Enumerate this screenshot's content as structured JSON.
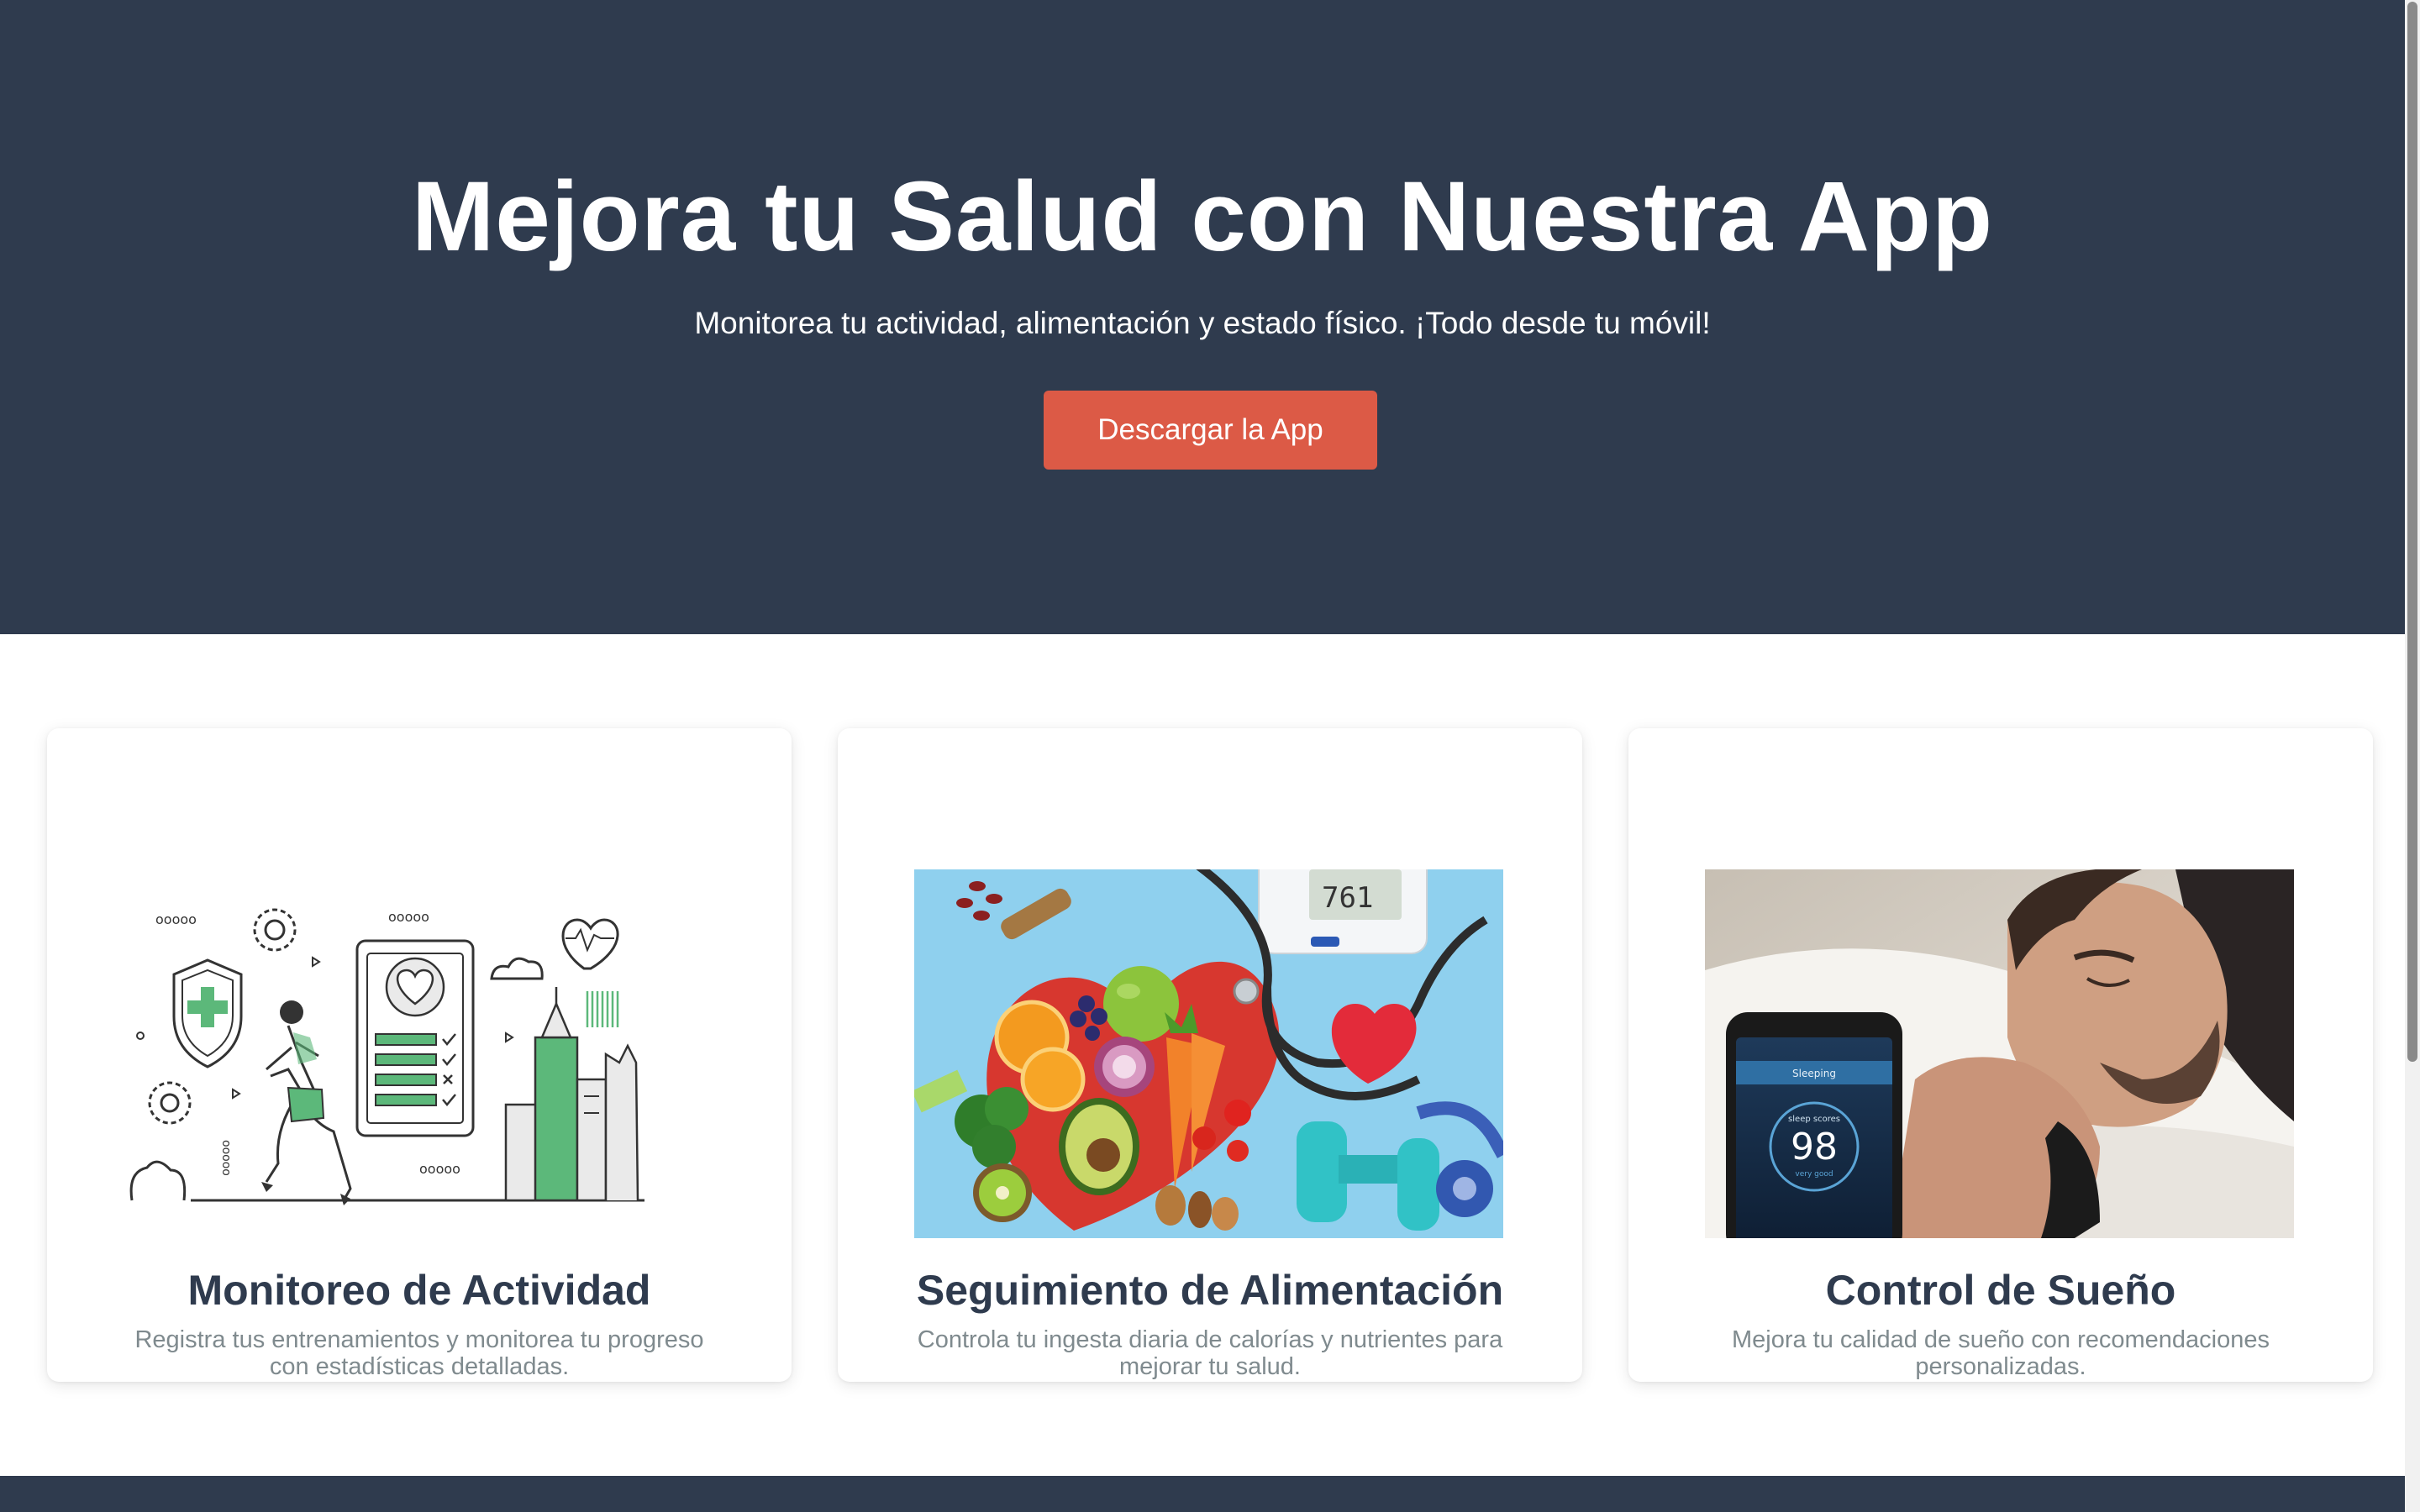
{
  "hero": {
    "title": "Mejora tu Salud con Nuestra App",
    "subtitle": "Monitorea tu actividad, alimentación y estado físico. ¡Todo desde tu móvil!",
    "cta_label": "Descargar la App"
  },
  "features": [
    {
      "title": "Monitoreo de Actividad",
      "description": "Registra tus entrenamientos y monitorea tu progreso con estadísticas detalladas.",
      "image": "activity-illustration"
    },
    {
      "title": "Seguimiento de Alimentación",
      "description": "Controla tu ingesta diaria de calorías y nutrientes para mejorar tu salud.",
      "image": "food-health-photo"
    },
    {
      "title": "Control de Sueño",
      "description": "Mejora tu calidad de sueño con recomendaciones personalizadas.",
      "image": "sleep-photo",
      "phone": {
        "app_title": "Sleeping",
        "score_label": "sleep scores",
        "score": "98",
        "rating": "very good"
      }
    }
  ],
  "colors": {
    "hero_bg": "#2f3b4e",
    "cta_bg": "#dc5a46",
    "title_text": "#2f3b4e",
    "desc_text": "#7f8a8e",
    "accent_green": "#5cb87a"
  }
}
